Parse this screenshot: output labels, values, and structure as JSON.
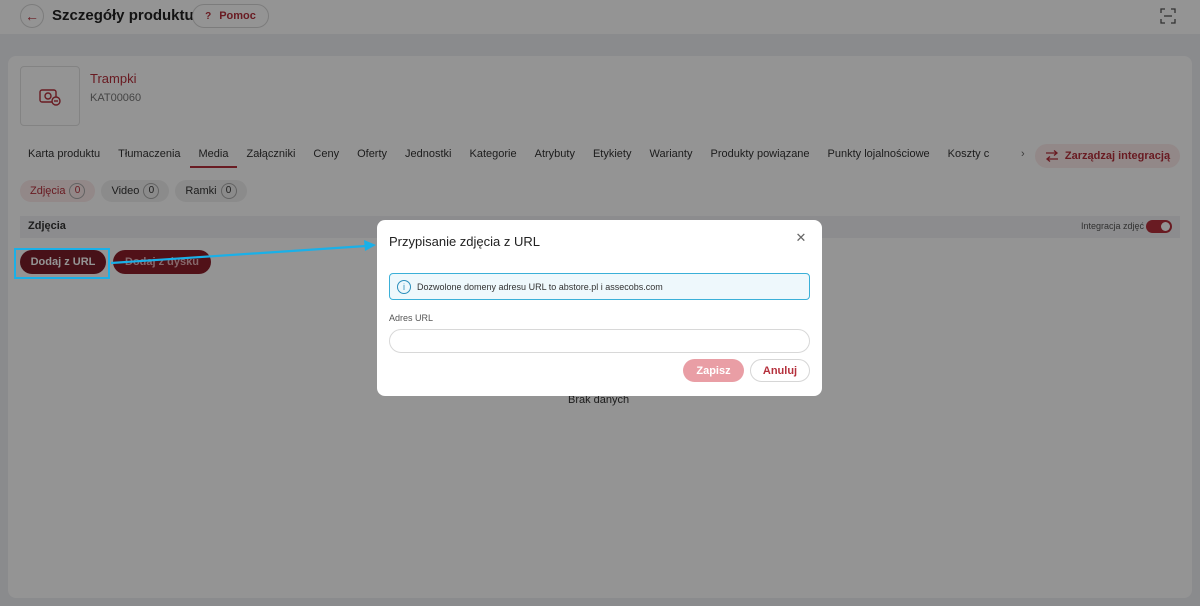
{
  "header": {
    "title": "Szczegóły produktu",
    "help_label": "Pomoc",
    "help_icon": "?"
  },
  "product": {
    "name": "Trampki",
    "code": "KAT00060"
  },
  "tabs": [
    {
      "label": "Karta produktu"
    },
    {
      "label": "Tłumaczenia"
    },
    {
      "label": "Media"
    },
    {
      "label": "Załączniki"
    },
    {
      "label": "Ceny"
    },
    {
      "label": "Oferty"
    },
    {
      "label": "Jednostki"
    },
    {
      "label": "Kategorie"
    },
    {
      "label": "Atrybuty"
    },
    {
      "label": "Etykiety"
    },
    {
      "label": "Warianty"
    },
    {
      "label": "Produkty powiązane"
    },
    {
      "label": "Punkty lojalnościowe"
    },
    {
      "label": "Koszty c"
    }
  ],
  "tabs_more": "›",
  "integration_button": "Zarządzaj integracją",
  "media_chips": [
    {
      "label": "Zdjęcia",
      "count": "0"
    },
    {
      "label": "Video",
      "count": "0"
    },
    {
      "label": "Ramki",
      "count": "0"
    }
  ],
  "section": {
    "title": "Zdjęcia",
    "toggle_label": "Integracja zdjęć"
  },
  "buttons": {
    "add_url": "Dodaj z URL",
    "add_disk": "Dodaj z dysku"
  },
  "empty_text": "Brak danych",
  "modal": {
    "title": "Przypisanie zdjęcia z URL",
    "info": "Dozwolone domeny adresu URL to abstore.pl i assecobs.com",
    "field_label": "Adres URL",
    "field_value": "",
    "save": "Zapisz",
    "cancel": "Anuluj"
  },
  "colors": {
    "accent": "#b5303c",
    "highlight": "#1ab0e8"
  }
}
